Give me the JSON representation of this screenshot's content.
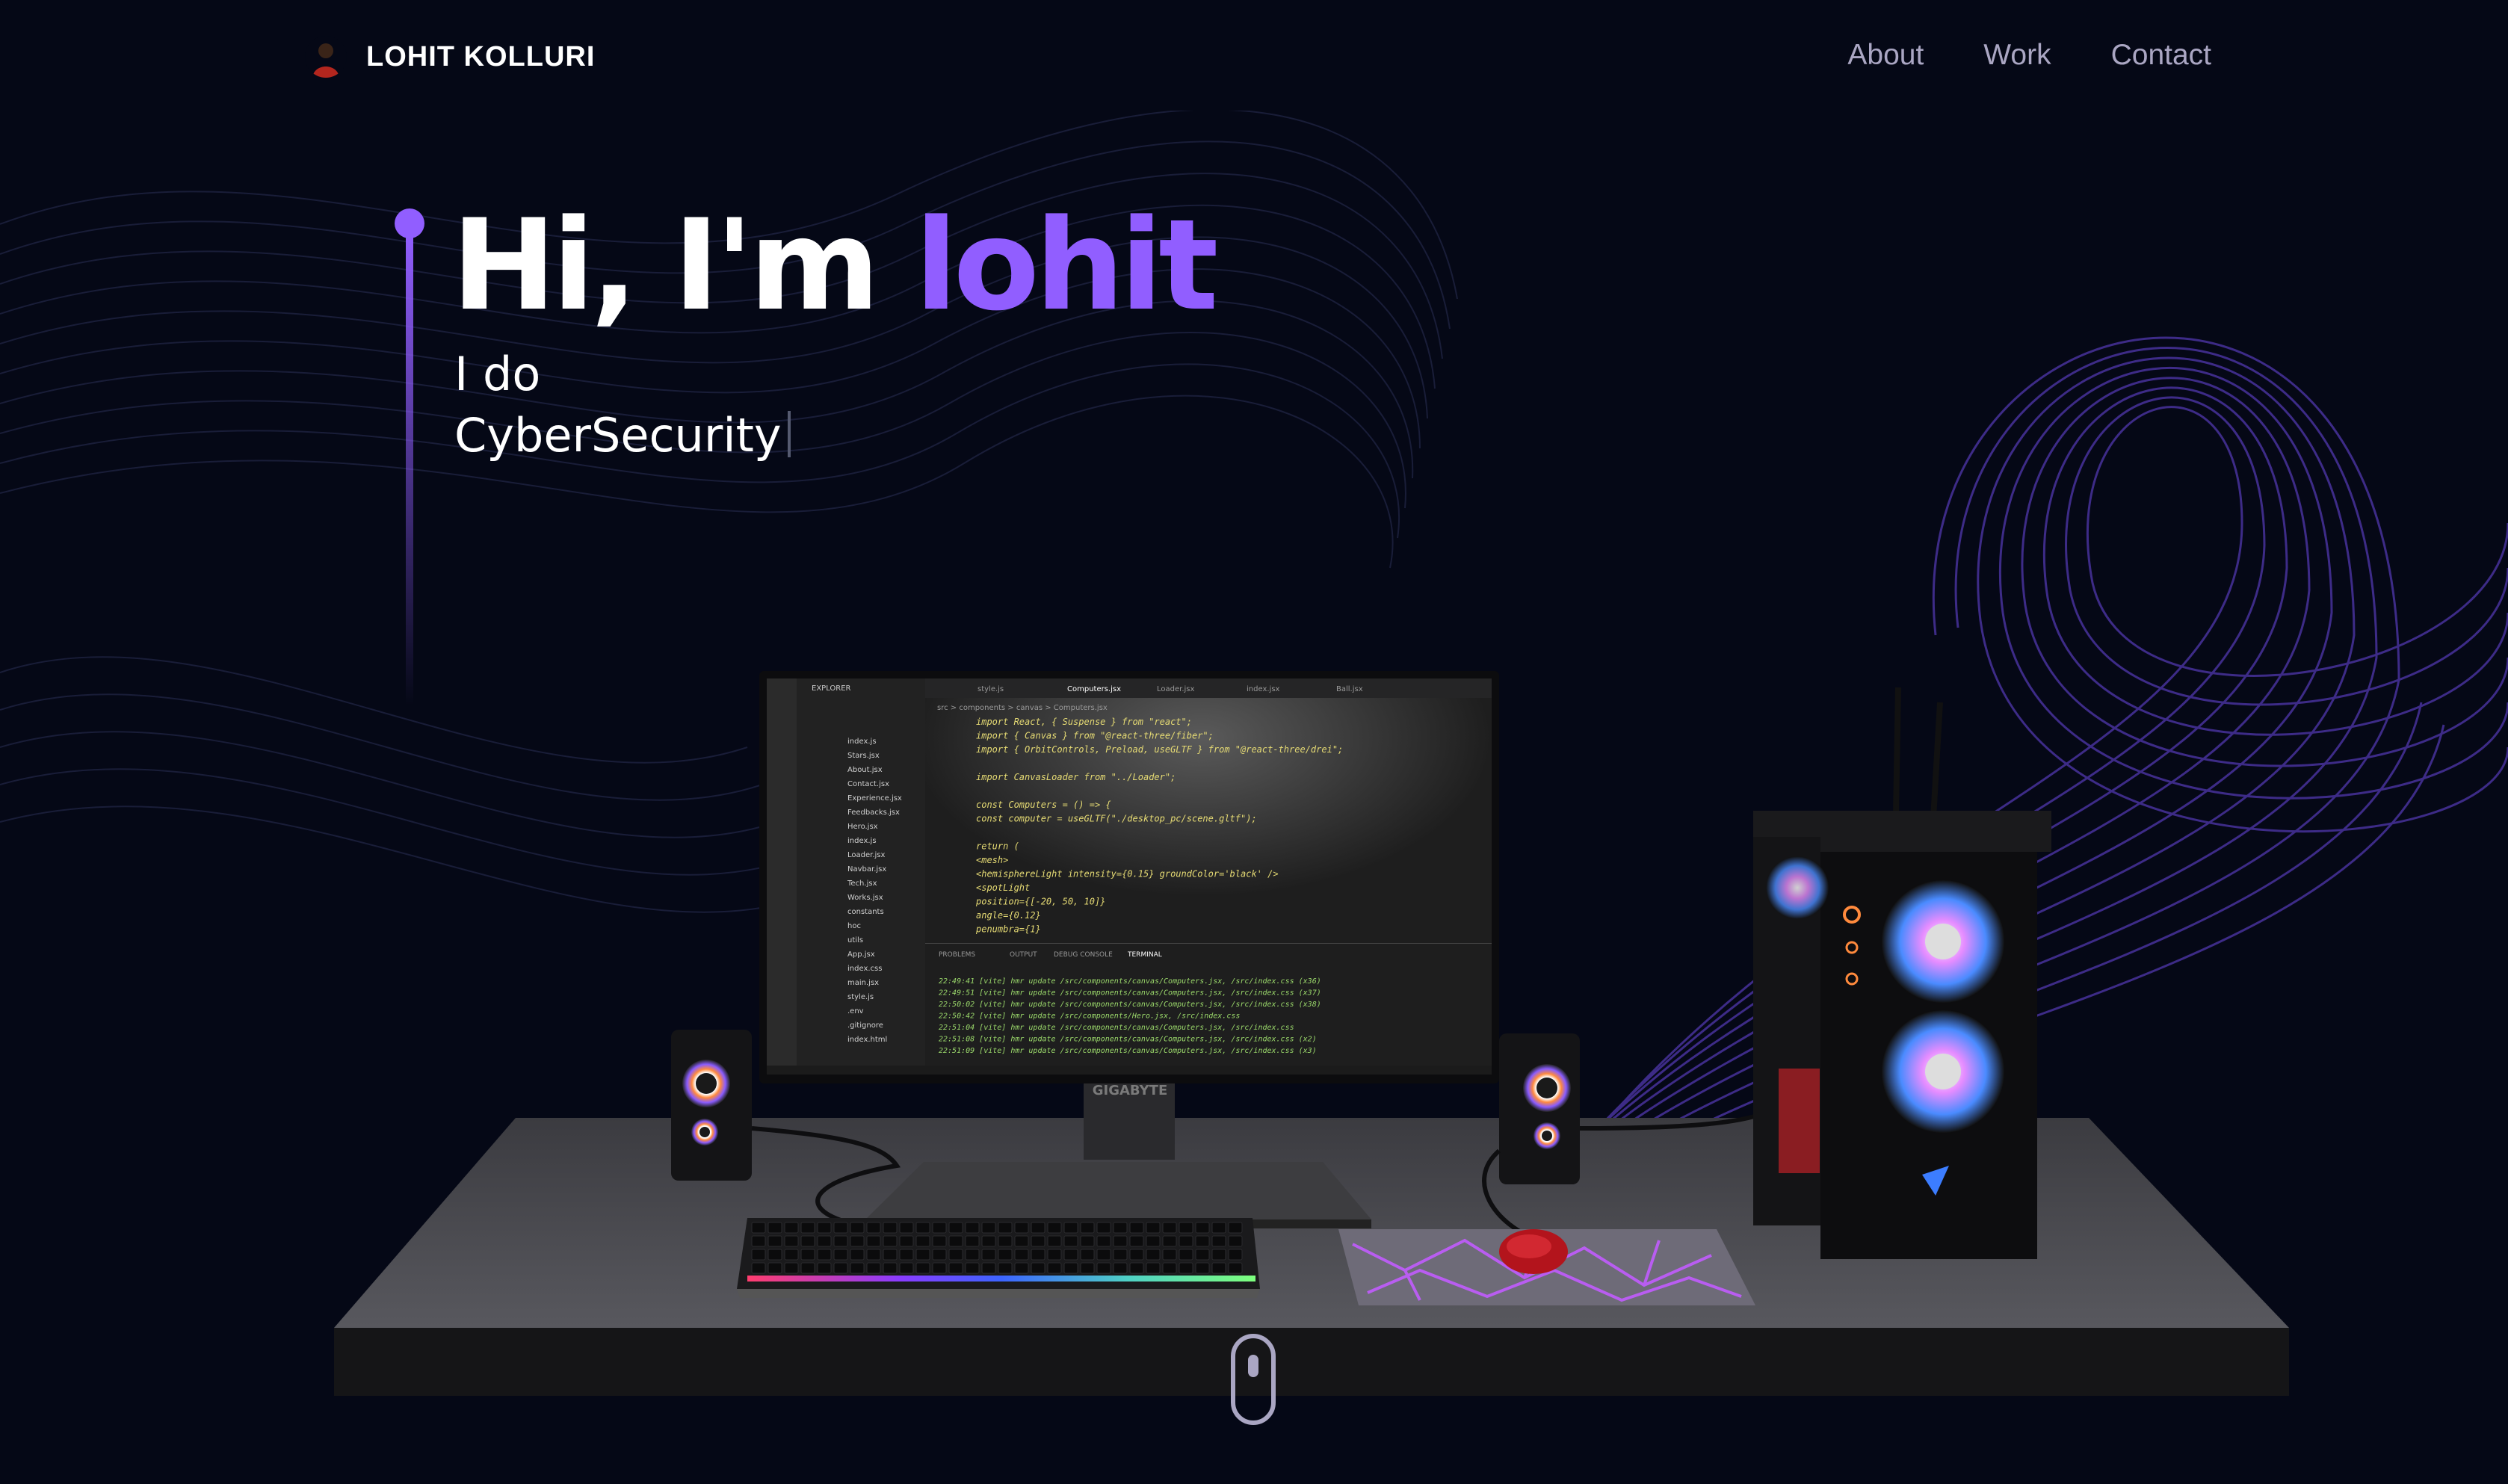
{
  "nav": {
    "brand": "LOHIT KOLLURI",
    "links": [
      "About",
      "Work",
      "Contact"
    ]
  },
  "hero": {
    "greeting": "Hi, I'm ",
    "name": "lohit",
    "line1": "I do",
    "line2": "CyberSecurity"
  },
  "monitor": {
    "brand": "GIGABYTE",
    "tabs": [
      "style.js",
      "Computers.jsx",
      "Loader.jsx",
      "index.jsx",
      "Ball.jsx"
    ],
    "explorer_title": "EXPLORER",
    "breadcrumb": "src > components > canvas > Computers.jsx",
    "panel_tabs": [
      "PROBLEMS",
      "OUTPUT",
      "DEBUG CONSOLE",
      "TERMINAL"
    ],
    "files": [
      "index.js",
      "Stars.jsx",
      "About.jsx",
      "Contact.jsx",
      "Experience.jsx",
      "Feedbacks.jsx",
      "Hero.jsx",
      "index.js",
      "Loader.jsx",
      "Navbar.jsx",
      "Tech.jsx",
      "Works.jsx",
      "constants",
      "hoc",
      "utils",
      "App.jsx",
      "index.css",
      "main.jsx",
      "style.js",
      ".env",
      ".gitignore",
      "index.html"
    ],
    "code": [
      "import React, { Suspense } from \"react\";",
      "import { Canvas } from \"@react-three/fiber\";",
      "import { OrbitControls, Preload, useGLTF } from \"@react-three/drei\";",
      "",
      "import CanvasLoader from \"../Loader\";",
      "",
      "const Computers = () => {",
      "  const computer = useGLTF(\"./desktop_pc/scene.gltf\");",
      "",
      "  return (",
      "    <mesh>",
      "      <hemisphereLight intensity={0.15} groundColor='black' />",
      "      <spotLight",
      "        position={[-20, 50, 10]}",
      "        angle={0.12}",
      "        penumbra={1}"
    ],
    "terminal": [
      "22:49:41 [vite] hmr update /src/components/canvas/Computers.jsx, /src/index.css (x36)",
      "22:49:51 [vite] hmr update /src/components/canvas/Computers.jsx, /src/index.css (x37)",
      "22:50:02 [vite] hmr update /src/components/canvas/Computers.jsx, /src/index.css (x38)",
      "22:50:42 [vite] hmr update /src/components/Hero.jsx, /src/index.css",
      "22:51:04 [vite] hmr update /src/components/canvas/Computers.jsx, /src/index.css",
      "22:51:08 [vite] hmr update /src/components/canvas/Computers.jsx, /src/index.css (x2)",
      "22:51:09 [vite] hmr update /src/components/canvas/Computers.jsx, /src/index.css (x3)"
    ]
  },
  "colors": {
    "background": "#050816",
    "accent": "#915eff",
    "nav_text": "#aaa6c3"
  }
}
